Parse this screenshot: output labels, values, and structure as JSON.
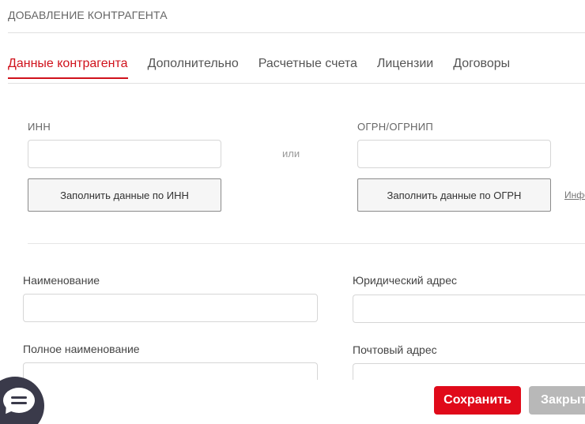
{
  "header": {
    "title": "ДОБАВЛЕНИЕ КОНТРАГЕНТА"
  },
  "tabs": [
    {
      "label": "Данные контрагента",
      "active": true
    },
    {
      "label": "Дополнительно",
      "active": false
    },
    {
      "label": "Расчетные счета",
      "active": false
    },
    {
      "label": "Лицензии",
      "active": false
    },
    {
      "label": "Договоры",
      "active": false
    }
  ],
  "lookup": {
    "inn_label": "ИНН",
    "inn_value": "",
    "or_text": "или",
    "ogrn_label": "ОГРН/ОГРНИП",
    "ogrn_value": "",
    "fill_by_inn": "Заполнить данные по ИНН",
    "fill_by_ogrn": "Заполнить данные по ОГРН",
    "info_link": "Инфо"
  },
  "form": {
    "name_label": "Наименование",
    "name_value": "",
    "full_name_label": "Полное наименование",
    "full_name_value": "",
    "legal_address_label": "Юридический адрес",
    "legal_address_value": "",
    "postal_address_label": "Почтовый адрес",
    "postal_address_value": ""
  },
  "footer": {
    "save_label": "Сохранить",
    "close_label": "Закрыть"
  },
  "colors": {
    "accent": "#d0121c",
    "save_bg": "#e00a1a",
    "close_bg": "#b8b8b8",
    "chat_widget_bg": "#3a3a4a"
  },
  "icons": {
    "chat": "chat-bubble-icon"
  }
}
